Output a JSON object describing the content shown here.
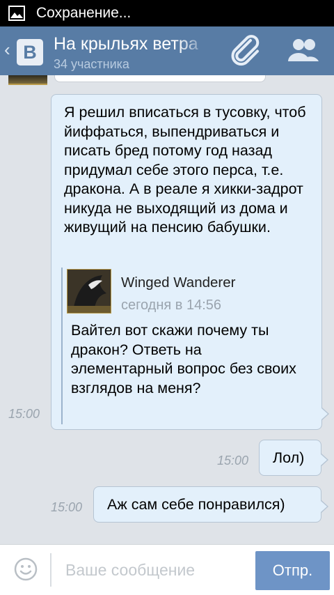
{
  "status_bar": {
    "text": "Сохранение...",
    "icon": "image-icon"
  },
  "header": {
    "back_glyph": "‹",
    "logo": "B",
    "title": "На крыльях ветра",
    "subtitle": "34 участника",
    "attach_icon": "paperclip-icon",
    "members_icon": "people-icon",
    "colors": {
      "header_bg": "#587ca5",
      "logo_bg": "#e9eef5"
    }
  },
  "messages": [
    {
      "direction": "out",
      "text": "Я решил вписаться в тусовку, чтоб йиффаться, выпендриваться и писать бред потому год назад придумал себе этого перса, т.е. дракона. А в реале я хикки-задрот никуда не выходящий из дома и живущий на пенсию бабушки.",
      "time": "15:00",
      "forwarded": {
        "author": "Winged Wanderer",
        "time": "сегодня в 14:56",
        "text": "Вайтел вот скажи почему ты дракон? Ответь на элементарный вопрос без своих взглядов на меня?"
      }
    },
    {
      "direction": "out",
      "text": "Лол)",
      "time": "15:00"
    },
    {
      "direction": "out",
      "text": "Аж сам себе понравился)",
      "time": "15:00"
    }
  ],
  "composer": {
    "placeholder": "Ваше сообщение",
    "send_label": "Отпр.",
    "smile_icon": "smile-icon",
    "colors": {
      "send_bg": "#6e94c6"
    }
  },
  "colors": {
    "chat_bg": "#dfe3e8",
    "bubble_out": "#e3f0fb",
    "bubble_border": "#b5c4d3"
  }
}
